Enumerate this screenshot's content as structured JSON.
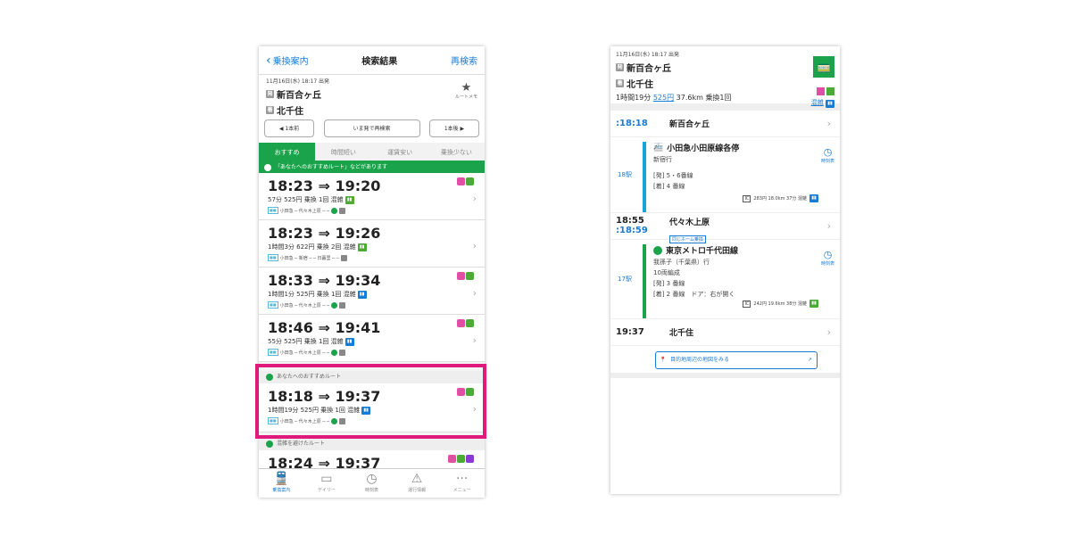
{
  "nav": {
    "back": "乗換案内",
    "title": "検索結果",
    "research": "再検索"
  },
  "hdr": {
    "datetime": "11月16日(水) 18:17 出発",
    "from": "新百合ヶ丘",
    "to": "北千住",
    "from_mk": "発",
    "to_mk": "着",
    "star_label": "ルートメモ"
  },
  "btns": {
    "prev": "◀ 1本前",
    "now": "いま発で再検索",
    "next": "1本後 ▶"
  },
  "tabs": [
    "おすすめ",
    "時間短い",
    "運賃安い",
    "乗換少ない"
  ],
  "banner": "「あなたへのおすすめルート」などがあります",
  "routes": [
    {
      "time": "18:23 ⇒ 19:20",
      "info": "57分 525円 乗換 1回 混雑",
      "line": "小田急 ─ 代々木上原 ─ ─"
    },
    {
      "time": "18:23 ⇒ 19:26",
      "info": "1時間3分 622円 乗換 2回 混雑",
      "line": "小田急 ─ 新宿 ─ ─ 日暮里 ─ ─"
    },
    {
      "time": "18:33 ⇒ 19:34",
      "info": "1時間1分 525円 乗換 1回 混雑",
      "line": "小田急 ─ 代々木上原 ─ ─"
    },
    {
      "time": "18:46 ⇒ 19:41",
      "info": "55分 525円 乗換 1回 混雑",
      "line": "小田急 ─ 代々木上原 ─ ─"
    },
    {
      "time": "18:18 ⇒ 19:37",
      "info": "1時間19分 525円 乗換 1回 混雑",
      "line": "小田急 ─ 代々木上原 ─ ─"
    },
    {
      "time": "18:24 ⇒ 19:37"
    }
  ],
  "sec1": "あなたへのおすすめルート",
  "sec2": "混雑を避けたルート",
  "tabbar": [
    "乗換案内",
    "デイリー",
    "時刻表",
    "運行情報",
    "メニュー"
  ],
  "detail": {
    "datetime": "11月16日(水) 18:17 出発",
    "from": "新百合ヶ丘",
    "to": "北千住",
    "summary_a": "1時間19分",
    "fare": "525円",
    "summary_b": "37.6km 乗換1回",
    "crowd": "混雑",
    "s1": {
      "time": ":18:18",
      "name": "新百合ヶ丘",
      "suf": "発"
    },
    "leg1": {
      "count": "18駅",
      "line": "小田急小田原線各停",
      "dir": "新宿行",
      "plat1": "[発] 5・6番線",
      "plat2": "[着] 4 番線",
      "meta": "283円 18.0km 37分 混雑",
      "clock": "時刻表"
    },
    "s2": {
      "time": "18:55",
      "name": "代々木上原",
      "time2": ":18:59",
      "note": "同じホーム乗換"
    },
    "leg2": {
      "count": "17駅",
      "line": "東京メトロ千代田線",
      "dir": "我孫子（千葉県）行",
      "cars": "10両編成",
      "plat1": "[発] 3 番線",
      "plat2": "[着] 2 番線　ドア：右が開く",
      "meta": "242円 19.6km 38分 混雑",
      "clock": "時刻表"
    },
    "s3": {
      "time": "19:37",
      "name": "北千住"
    },
    "map": "目的地周辺の地図をみる"
  }
}
